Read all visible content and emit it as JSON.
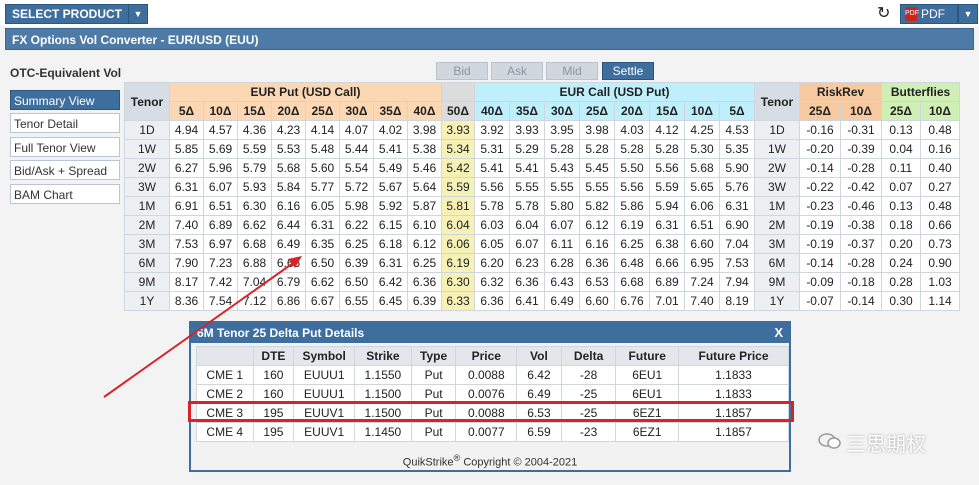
{
  "topbar": {
    "select_product": "SELECT PRODUCT",
    "pdf_label": "PDF",
    "pdf_icon_text": "PDF"
  },
  "title": "FX Options Vol Converter - EUR/USD (EUU)",
  "sidebar": {
    "heading": "OTC-Equivalent Vol",
    "items": [
      {
        "label": "Summary View",
        "active": true
      },
      {
        "label": "Tenor Detail",
        "active": false
      },
      {
        "label": "Full Tenor View",
        "active": false
      },
      {
        "label": "Bid/Ask + Spread",
        "active": false
      },
      {
        "label": "BAM Chart",
        "active": false
      }
    ]
  },
  "toggles": [
    "Bid",
    "Ask",
    "Mid",
    "Settle"
  ],
  "table": {
    "tenor_header": "Tenor",
    "put_header": "EUR Put (USD Call)",
    "call_header": "EUR Call (USD Put)",
    "rr_header": "RiskRev",
    "bf_header": "Butterflies",
    "put_deltas": [
      "5Δ",
      "10Δ",
      "15Δ",
      "20Δ",
      "25Δ",
      "30Δ",
      "35Δ",
      "40Δ"
    ],
    "atm_delta": "50Δ",
    "call_deltas": [
      "40Δ",
      "35Δ",
      "30Δ",
      "25Δ",
      "20Δ",
      "15Δ",
      "10Δ",
      "5Δ"
    ],
    "rr_deltas": [
      "25Δ",
      "10Δ"
    ],
    "bf_deltas": [
      "25Δ",
      "10Δ"
    ],
    "rows": [
      {
        "tenor": "1D",
        "put": [
          "4.94",
          "4.57",
          "4.36",
          "4.23",
          "4.14",
          "4.07",
          "4.02",
          "3.98"
        ],
        "atm": "3.93",
        "call": [
          "3.92",
          "3.93",
          "3.95",
          "3.98",
          "4.03",
          "4.12",
          "4.25",
          "4.53"
        ],
        "rr": [
          "-0.16",
          "-0.31"
        ],
        "bf": [
          "0.13",
          "0.48"
        ]
      },
      {
        "tenor": "1W",
        "put": [
          "5.85",
          "5.69",
          "5.59",
          "5.53",
          "5.48",
          "5.44",
          "5.41",
          "5.38"
        ],
        "atm": "5.34",
        "call": [
          "5.31",
          "5.29",
          "5.28",
          "5.28",
          "5.28",
          "5.28",
          "5.30",
          "5.35"
        ],
        "rr": [
          "-0.20",
          "-0.39"
        ],
        "bf": [
          "0.04",
          "0.16"
        ]
      },
      {
        "tenor": "2W",
        "put": [
          "6.27",
          "5.96",
          "5.79",
          "5.68",
          "5.60",
          "5.54",
          "5.49",
          "5.46"
        ],
        "atm": "5.42",
        "call": [
          "5.41",
          "5.41",
          "5.43",
          "5.45",
          "5.50",
          "5.56",
          "5.68",
          "5.90"
        ],
        "rr": [
          "-0.14",
          "-0.28"
        ],
        "bf": [
          "0.11",
          "0.40"
        ]
      },
      {
        "tenor": "3W",
        "put": [
          "6.31",
          "6.07",
          "5.93",
          "5.84",
          "5.77",
          "5.72",
          "5.67",
          "5.64"
        ],
        "atm": "5.59",
        "call": [
          "5.56",
          "5.55",
          "5.55",
          "5.55",
          "5.56",
          "5.59",
          "5.65",
          "5.76"
        ],
        "rr": [
          "-0.22",
          "-0.42"
        ],
        "bf": [
          "0.07",
          "0.27"
        ]
      },
      {
        "tenor": "1M",
        "put": [
          "6.91",
          "6.51",
          "6.30",
          "6.16",
          "6.05",
          "5.98",
          "5.92",
          "5.87"
        ],
        "atm": "5.81",
        "call": [
          "5.78",
          "5.78",
          "5.80",
          "5.82",
          "5.86",
          "5.94",
          "6.06",
          "6.31"
        ],
        "rr": [
          "-0.23",
          "-0.46"
        ],
        "bf": [
          "0.13",
          "0.48"
        ]
      },
      {
        "tenor": "2M",
        "put": [
          "7.40",
          "6.89",
          "6.62",
          "6.44",
          "6.31",
          "6.22",
          "6.15",
          "6.10"
        ],
        "atm": "6.04",
        "call": [
          "6.03",
          "6.04",
          "6.07",
          "6.12",
          "6.19",
          "6.31",
          "6.51",
          "6.90"
        ],
        "rr": [
          "-0.19",
          "-0.38"
        ],
        "bf": [
          "0.18",
          "0.66"
        ]
      },
      {
        "tenor": "3M",
        "put": [
          "7.53",
          "6.97",
          "6.68",
          "6.49",
          "6.35",
          "6.25",
          "6.18",
          "6.12"
        ],
        "atm": "6.06",
        "call": [
          "6.05",
          "6.07",
          "6.11",
          "6.16",
          "6.25",
          "6.38",
          "6.60",
          "7.04"
        ],
        "rr": [
          "-0.19",
          "-0.37"
        ],
        "bf": [
          "0.20",
          "0.73"
        ]
      },
      {
        "tenor": "6M",
        "put": [
          "7.90",
          "7.23",
          "6.88",
          "6.66",
          "6.50",
          "6.39",
          "6.31",
          "6.25"
        ],
        "atm": "6.19",
        "call": [
          "6.20",
          "6.23",
          "6.28",
          "6.36",
          "6.48",
          "6.66",
          "6.95",
          "7.53"
        ],
        "rr": [
          "-0.14",
          "-0.28"
        ],
        "bf": [
          "0.24",
          "0.90"
        ]
      },
      {
        "tenor": "9M",
        "put": [
          "8.17",
          "7.42",
          "7.04",
          "6.79",
          "6.62",
          "6.50",
          "6.42",
          "6.36"
        ],
        "atm": "6.30",
        "call": [
          "6.32",
          "6.36",
          "6.43",
          "6.53",
          "6.68",
          "6.89",
          "7.24",
          "7.94"
        ],
        "rr": [
          "-0.09",
          "-0.18"
        ],
        "bf": [
          "0.28",
          "1.03"
        ]
      },
      {
        "tenor": "1Y",
        "put": [
          "8.36",
          "7.54",
          "7.12",
          "6.86",
          "6.67",
          "6.55",
          "6.45",
          "6.39"
        ],
        "atm": "6.33",
        "call": [
          "6.36",
          "6.41",
          "6.49",
          "6.60",
          "6.76",
          "7.01",
          "7.40",
          "8.19"
        ],
        "rr": [
          "-0.07",
          "-0.14"
        ],
        "bf": [
          "0.30",
          "1.14"
        ]
      }
    ]
  },
  "popup": {
    "title": "6M Tenor 25 Delta Put Details",
    "close": "X",
    "headers": [
      "",
      "DTE",
      "Symbol",
      "Strike",
      "Type",
      "Price",
      "Vol",
      "Delta",
      "Future",
      "Future Price"
    ],
    "rows": [
      [
        "CME 1",
        "160",
        "EUUU1",
        "1.1550",
        "Put",
        "0.0088",
        "6.42",
        "-28",
        "6EU1",
        "1.1833"
      ],
      [
        "CME 2",
        "160",
        "EUUU1",
        "1.1500",
        "Put",
        "0.0076",
        "6.49",
        "-25",
        "6EU1",
        "1.1833"
      ],
      [
        "CME 3",
        "195",
        "EUUV1",
        "1.1500",
        "Put",
        "0.0088",
        "6.53",
        "-25",
        "6EZ1",
        "1.1857"
      ],
      [
        "CME 4",
        "195",
        "EUUV1",
        "1.1450",
        "Put",
        "0.0077",
        "6.59",
        "-23",
        "6EZ1",
        "1.1857"
      ]
    ],
    "highlighted_row": 2,
    "footer_brand": "QuikStrike",
    "footer_reg": "®",
    "footer_copy": "Copyright © 2004-2021"
  },
  "watermark": "三思期权",
  "colors": {
    "accent": "#3e6e9e",
    "highlight": "#d8232a",
    "put": "#fbd7b4",
    "call": "#bfeffa",
    "atm": "#f6f2b6"
  }
}
